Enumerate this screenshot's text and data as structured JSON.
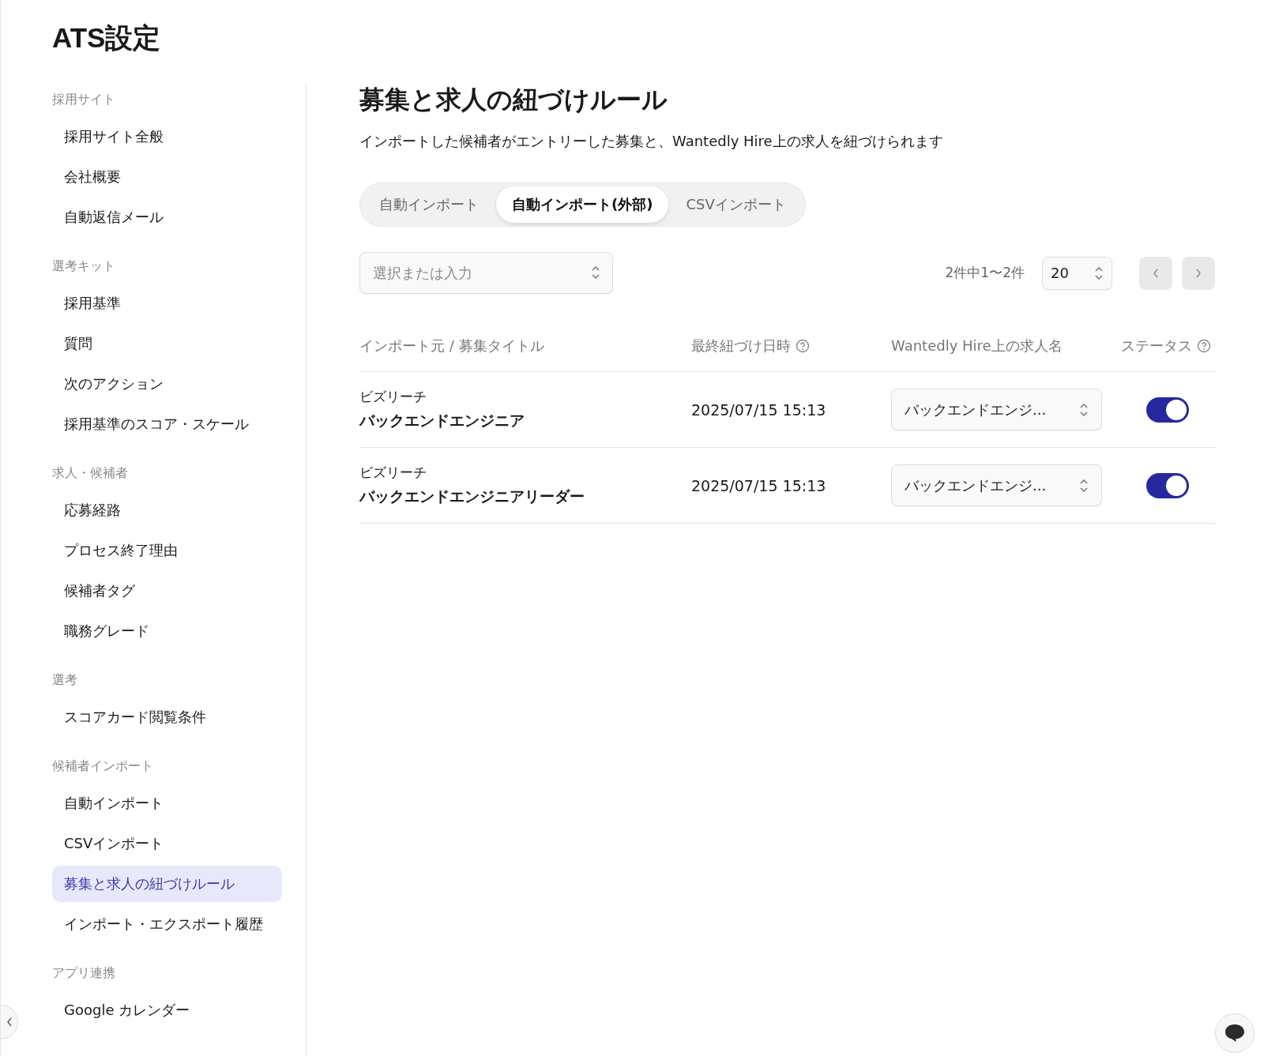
{
  "sidebar": {
    "title": "ATS設定",
    "groups": [
      {
        "heading": "採用サイト",
        "items": [
          {
            "label": "採用サイト全般",
            "selected": false
          },
          {
            "label": "会社概要",
            "selected": false
          },
          {
            "label": "自動返信メール",
            "selected": false
          }
        ]
      },
      {
        "heading": "選考キット",
        "items": [
          {
            "label": "採用基準",
            "selected": false
          },
          {
            "label": "質問",
            "selected": false
          },
          {
            "label": "次のアクション",
            "selected": false
          },
          {
            "label": "採用基準のスコア・スケール",
            "selected": false
          }
        ]
      },
      {
        "heading": "求人・候補者",
        "items": [
          {
            "label": "応募経路",
            "selected": false
          },
          {
            "label": "プロセス終了理由",
            "selected": false
          },
          {
            "label": "候補者タグ",
            "selected": false
          },
          {
            "label": "職務グレード",
            "selected": false
          }
        ]
      },
      {
        "heading": "選考",
        "items": [
          {
            "label": "スコアカード閲覧条件",
            "selected": false
          }
        ]
      },
      {
        "heading": "候補者インポート",
        "items": [
          {
            "label": "自動インポート",
            "selected": false
          },
          {
            "label": "CSVインポート",
            "selected": false
          },
          {
            "label": "募集と求人の紐づけルール",
            "selected": true
          },
          {
            "label": "インポート・エクスポート履歴",
            "selected": false
          }
        ]
      },
      {
        "heading": "アプリ連携",
        "items": [
          {
            "label": "Google カレンダー",
            "selected": false
          }
        ]
      }
    ]
  },
  "main": {
    "title": "募集と求人の紐づけルール",
    "description": "インポートした候補者がエントリーした募集と、Wantedly Hire上の求人を紐づけられます",
    "tabs": [
      {
        "label": "自動インポート",
        "selected": false
      },
      {
        "label": "自動インポート(外部)",
        "selected": true
      },
      {
        "label": "CSVインポート",
        "selected": false
      }
    ],
    "filter": {
      "placeholder": "選択または入力"
    },
    "pagination": {
      "summary": "2件中1〜2件",
      "page_size": "20"
    },
    "table": {
      "columns": [
        {
          "label": "インポート元 / 募集タイトル",
          "help": false
        },
        {
          "label": "最終紐づけ日時",
          "help": true
        },
        {
          "label": "Wantedly Hire上の求人名",
          "help": false
        },
        {
          "label": "ステータス",
          "help": true
        }
      ],
      "rows": [
        {
          "source": "ビズリーチ",
          "title": "バックエンドエンジニア",
          "updated": "2025/07/15 15:13",
          "job": "バックエンドエンジ...",
          "enabled": true
        },
        {
          "source": "ビズリーチ",
          "title": "バックエンドエンジニアリーダー",
          "updated": "2025/07/15 15:13",
          "job": "バックエンドエンジ...",
          "enabled": true
        }
      ]
    }
  }
}
